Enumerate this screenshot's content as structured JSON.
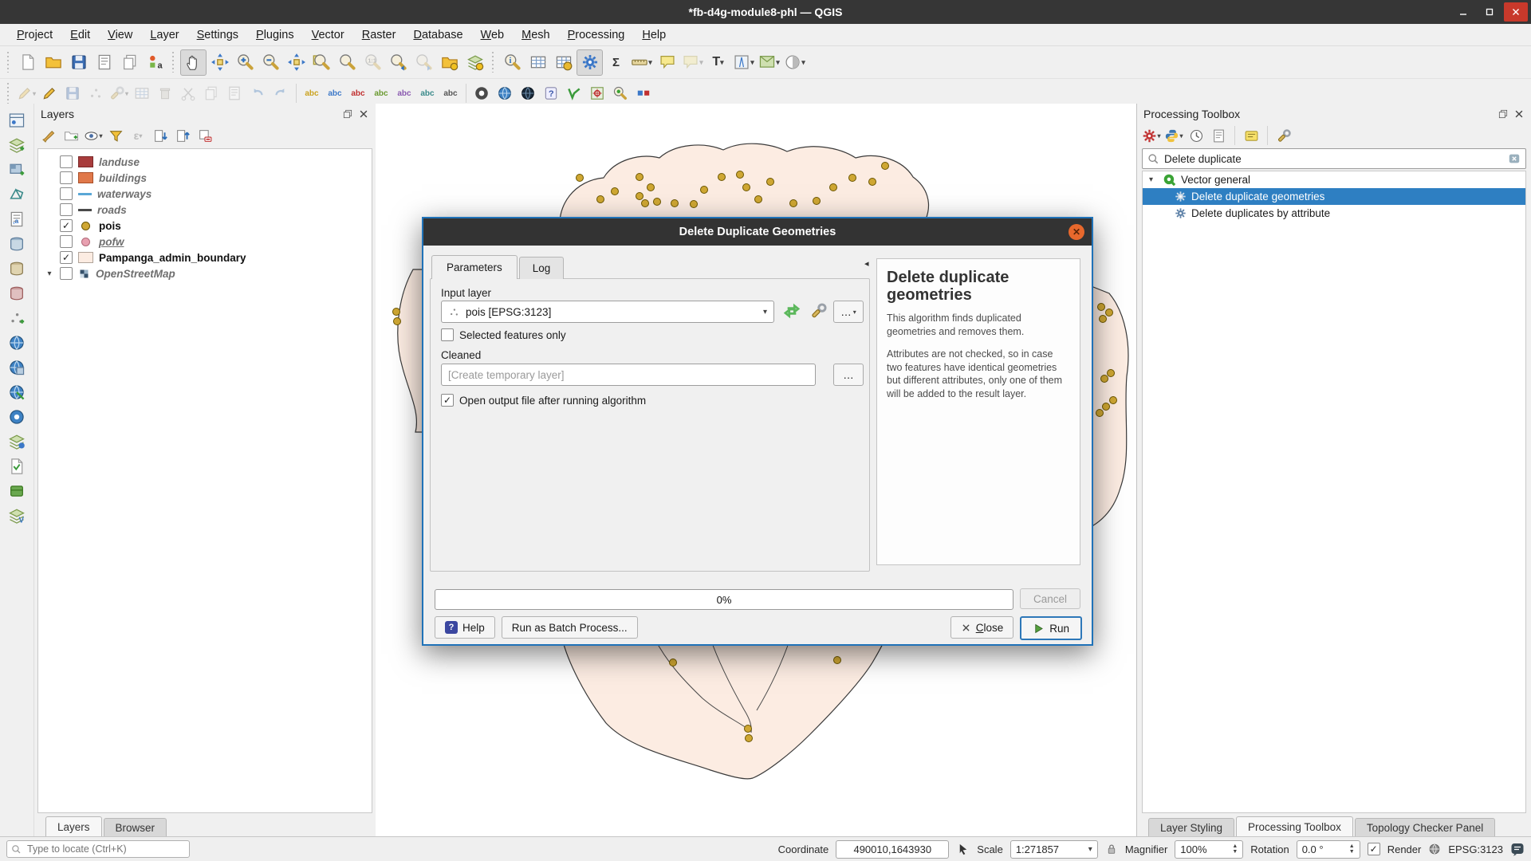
{
  "window": {
    "title": "*fb-d4g-module8-phl — QGIS"
  },
  "menu": {
    "items": [
      "Project",
      "Edit",
      "View",
      "Layer",
      "Settings",
      "Plugins",
      "Vector",
      "Raster",
      "Database",
      "Web",
      "Mesh",
      "Processing",
      "Help"
    ]
  },
  "toolbar_icons": {
    "row1": [
      "new-project",
      "open-project",
      "save-project",
      "new-print-layout",
      "show-layout-manager",
      "style-manager",
      "pan-map",
      "pan-to-selection",
      "zoom-in",
      "zoom-out",
      "zoom-full",
      "zoom-to-selection",
      "zoom-to-layer",
      "zoom-native",
      "zoom-last",
      "zoom-next",
      "new-3d-map",
      "new-bookmark",
      "identify-features",
      "attribute-table",
      "refresh",
      "processing-toolbox",
      "statistics",
      "measure",
      "map-tips",
      "new-annotation",
      "text-annotation",
      "decorations"
    ],
    "row2": [
      "current-edits",
      "toggle-editing",
      "save-edits",
      "digitize",
      "vertex-tool",
      "modify-attributes",
      "delete-selected",
      "cut-features",
      "copy-features",
      "paste-features",
      "undo",
      "redo",
      "layer-labeling",
      "layer-diagram",
      "label-pin",
      "label-highlight",
      "label-callout",
      "osm-place-search",
      "metasearch",
      "mesh-calculator",
      "python-console",
      "help-contents",
      "vector-misc",
      "georeferencer"
    ],
    "left_strip": [
      "open-data-source-manager",
      "add-vector-layer",
      "add-raster-layer",
      "add-mesh-layer",
      "add-delimited-text-layer",
      "add-postgis-layer",
      "add-spatialite-layer",
      "add-mssql-layer",
      "add-oracle-layer",
      "add-wms-layer",
      "add-wcs-layer",
      "add-wfs-layer",
      "add-arcgis-rest-layer",
      "add-virtual-layer",
      "new-shapefile-layer",
      "new-geopackage-layer"
    ]
  },
  "layers_panel": {
    "title": "Layers",
    "tools": [
      "open-layer-styling",
      "add-group",
      "manage-map-themes",
      "filter-legend",
      "filter-by-expression",
      "expand-all",
      "collapse-all",
      "remove-layer"
    ],
    "layers": [
      {
        "label": "landuse"
      },
      {
        "label": "buildings"
      },
      {
        "label": "waterways"
      },
      {
        "label": "roads"
      },
      {
        "label": "pois"
      },
      {
        "label": "pofw"
      },
      {
        "label": "Pampanga_admin_boundary"
      },
      {
        "label": "OpenStreetMap"
      }
    ],
    "tabs": [
      "Layers",
      "Browser"
    ]
  },
  "dialog": {
    "title": "Delete Duplicate Geometries",
    "tabs": [
      "Parameters",
      "Log"
    ],
    "fields": {
      "input_layer_label": "Input layer",
      "input_layer_value": "pois [EPSG:3123]",
      "selected_features_label": "Selected features only",
      "cleaned_label": "Cleaned",
      "cleaned_placeholder": "[Create temporary layer]",
      "open_output_label": "Open output file after running algorithm"
    },
    "help": {
      "heading": "Delete duplicate geometries",
      "para1": "This algorithm finds duplicated geometries and removes them.",
      "para2": "Attributes are not checked, so in case two features have identical geometries but different attributes, only one of them will be added to the result layer."
    },
    "progress_value": "0%",
    "buttons": {
      "cancel": "Cancel",
      "help": "Help",
      "batch": "Run as Batch Process...",
      "close_accel": "C",
      "close_rest": "lose",
      "run": "Run"
    }
  },
  "processing_panel": {
    "title": "Processing Toolbox",
    "tools": [
      "processing-options",
      "python-scripts",
      "history",
      "log",
      "edit-features-in-place",
      "options"
    ],
    "search_value": "Delete duplicate",
    "group_label": "Vector general",
    "items": [
      {
        "label": "Delete duplicate geometries",
        "selected": true
      },
      {
        "label": "Delete duplicates by attribute",
        "selected": false
      }
    ],
    "tabs": [
      "Layer Styling",
      "Processing Toolbox",
      "Topology Checker Panel"
    ]
  },
  "status_bar": {
    "locator_placeholder": "Type to locate (Ctrl+K)",
    "coordinate_label": "Coordinate",
    "coordinate_value": "490010,1643930",
    "scale_label": "Scale",
    "scale_value": "1:271857",
    "magnifier_label": "Magnifier",
    "magnifier_value": "100%",
    "rotation_label": "Rotation",
    "rotation_value": "0.0 °",
    "render_label": "Render",
    "crs_value": "EPSG:3123"
  },
  "glyphs": {
    "dropdown": "▾",
    "check": "✓",
    "iterate": "⟳",
    "ellipsis": "…",
    "collapse_left": "◂",
    "question": "?",
    "sigma": "Σ",
    "epsilon": "ε",
    "one_to_one": "1:1",
    "abc": "abc",
    "tree_expanded": "▾",
    "close_x": "✕"
  },
  "colors": {
    "selection_blue": "#2e7fc2",
    "dialog_border": "#1f72b8",
    "boundary_fill": "#fcece2",
    "poi_fill": "#cfa733",
    "pofw_fill": "#e8a0b0",
    "landuse_fill": "#a83c3c",
    "buildings_fill": "#e0784a",
    "waterways_stroke": "#5aa7d6",
    "roads_stroke": "#4a4a4a"
  }
}
